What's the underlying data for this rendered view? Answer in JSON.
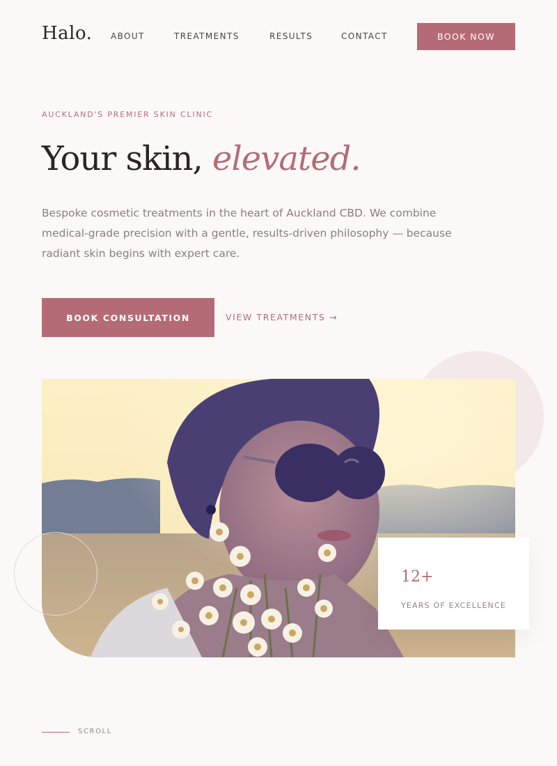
{
  "brand": {
    "logo": "Halo."
  },
  "nav": {
    "items": [
      {
        "label": "ABOUT"
      },
      {
        "label": "TREATMENTS"
      },
      {
        "label": "RESULTS"
      },
      {
        "label": "CONTACT"
      }
    ],
    "cta_label": "BOOK NOW"
  },
  "hero": {
    "eyebrow": "AUCKLAND'S PREMIER SKIN CLINIC",
    "headline_main": "Your skin, ",
    "headline_accent": "elevated.",
    "intro": "Bespoke cosmetic treatments in the heart of Auckland CBD. We combine medical-grade precision with a gentle, results-driven philosophy — because radiant skin begins with expert care.",
    "primary_cta": "BOOK CONSULTATION",
    "secondary_cta": "VIEW TREATMENTS →"
  },
  "stat": {
    "number": "12+",
    "label": "YEARS OF EXCELLENCE"
  },
  "scroll": {
    "label": "SCROLL"
  },
  "colors": {
    "accent": "#b56b75",
    "background": "#fbf9f8",
    "text_dark": "#2a2423",
    "text_muted": "#8c7d7f"
  }
}
